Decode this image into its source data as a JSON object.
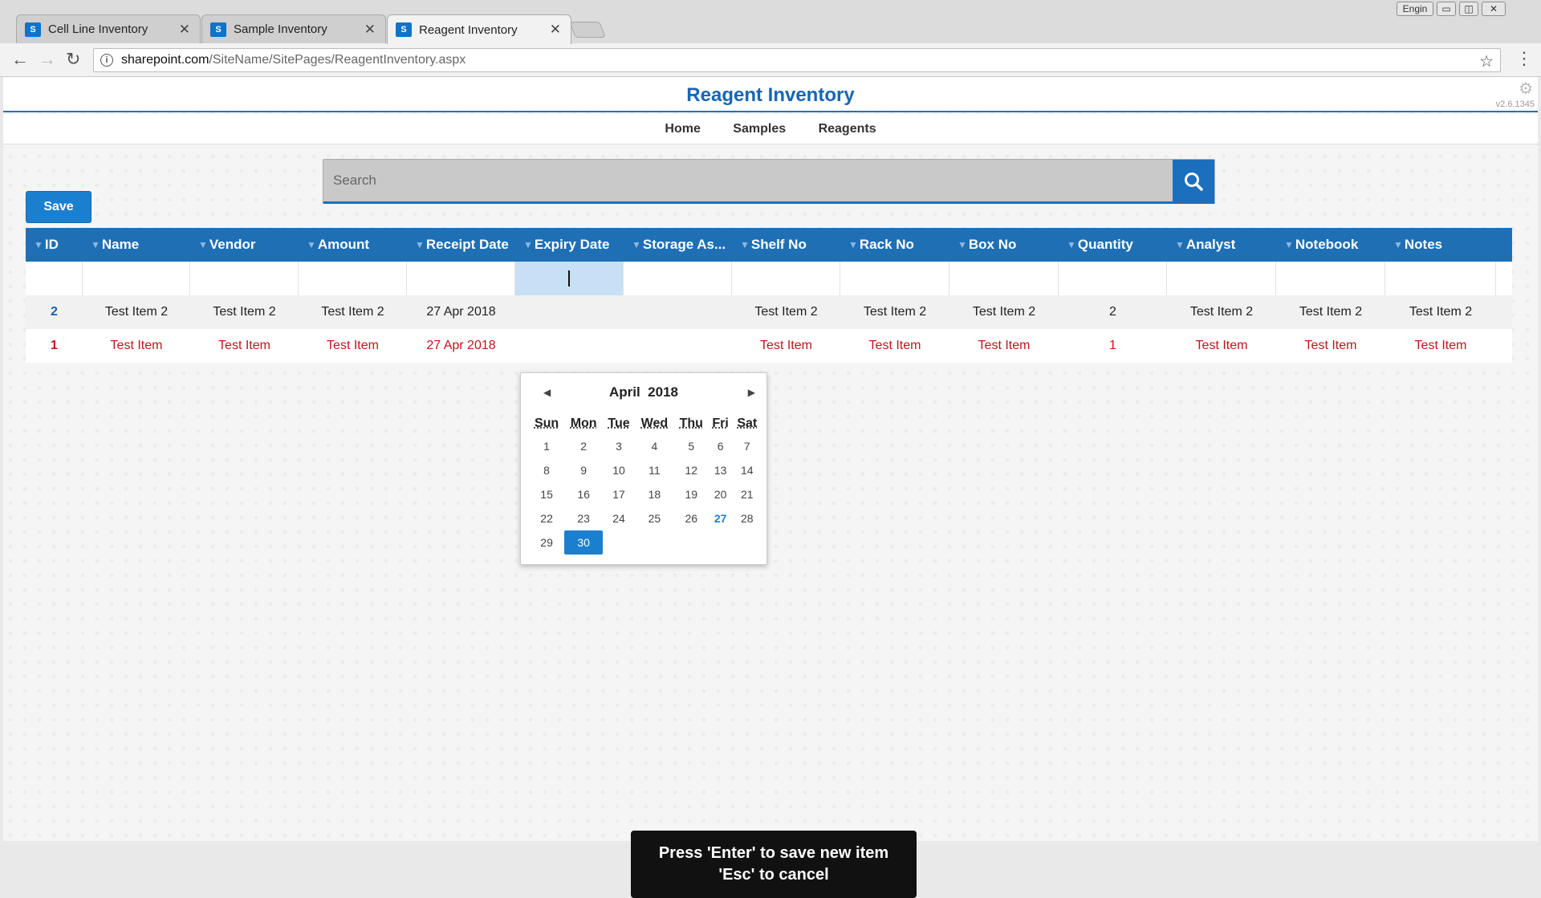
{
  "browser": {
    "tabs": [
      {
        "title": "Cell Line Inventory",
        "active": false
      },
      {
        "title": "Sample Inventory",
        "active": false
      },
      {
        "title": "Reagent Inventory",
        "active": true
      }
    ],
    "window_label": "Engin",
    "url_host": "sharepoint.com",
    "url_path": "/SiteName/SitePages/ReagentInventory.aspx"
  },
  "site": {
    "title": "Reagent Inventory",
    "version": "v2.6.1345",
    "nav": [
      "Home",
      "Samples",
      "Reagents"
    ]
  },
  "search": {
    "placeholder": "Search"
  },
  "toolbar": {
    "save_label": "Save"
  },
  "grid": {
    "columns": [
      "ID",
      "Name",
      "Vendor",
      "Amount",
      "Receipt Date",
      "Expiry Date",
      "Storage As...",
      "Shelf No",
      "Rack No",
      "Box No",
      "Quantity",
      "Analyst",
      "Notebook",
      "Notes"
    ],
    "rows": [
      [
        "2",
        "Test Item 2",
        "Test Item 2",
        "Test Item 2",
        "27 Apr 2018",
        "",
        "",
        "Test Item 2",
        "Test Item 2",
        "Test Item 2",
        "2",
        "Test Item 2",
        "Test Item 2",
        "Test Item 2"
      ],
      [
        "1",
        "Test Item",
        "Test Item",
        "Test Item",
        "27 Apr 2018",
        "",
        "",
        "Test Item",
        "Test Item",
        "Test Item",
        "1",
        "Test Item",
        "Test Item",
        "Test Item"
      ]
    ]
  },
  "datepicker": {
    "month": "April",
    "year": "2018",
    "weekdays": [
      "Sun",
      "Mon",
      "Tue",
      "Wed",
      "Thu",
      "Fri",
      "Sat"
    ],
    "weeks": [
      [
        "1",
        "2",
        "3",
        "4",
        "5",
        "6",
        "7"
      ],
      [
        "8",
        "9",
        "10",
        "11",
        "12",
        "13",
        "14"
      ],
      [
        "15",
        "16",
        "17",
        "18",
        "19",
        "20",
        "21"
      ],
      [
        "22",
        "23",
        "24",
        "25",
        "26",
        "27",
        "28"
      ],
      [
        "29",
        "30",
        "",
        "",
        "",
        "",
        ""
      ]
    ],
    "today": "27",
    "selected": "30"
  },
  "toast": {
    "line1": "Press 'Enter' to save new item",
    "line2": "'Esc' to cancel"
  },
  "colors": {
    "accent": "#1b7fd0",
    "header": "#1f6fb5",
    "error_row": "#c0151d"
  }
}
